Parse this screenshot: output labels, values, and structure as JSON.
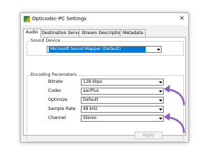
{
  "window": {
    "title": "Opticodec-PC Settings",
    "close_glyph": "✕"
  },
  "tabs": [
    {
      "label": "Audio",
      "active": true
    },
    {
      "label": "Destination Server",
      "active": false
    },
    {
      "label": "Stream Description",
      "active": false
    },
    {
      "label": "Metadata",
      "active": false
    }
  ],
  "sound_device": {
    "group_title": "Sound Device",
    "device": "Microsoft Sound Mapper (Default)"
  },
  "encoding": {
    "group_title": "Encoding Parameters",
    "params": [
      {
        "label": "Bitrate",
        "value": "128 kbps"
      },
      {
        "label": "Codec",
        "value": "aacPlus"
      },
      {
        "label": "Optimize",
        "value": "Default"
      },
      {
        "label": "Sample Rate",
        "value": "48 kHz"
      },
      {
        "label": "Channel",
        "value": "Stereo"
      }
    ],
    "apply_label": "Apply"
  },
  "colors": {
    "selection": "#0078d7",
    "annotation_arrow": "#8a5cc7"
  }
}
